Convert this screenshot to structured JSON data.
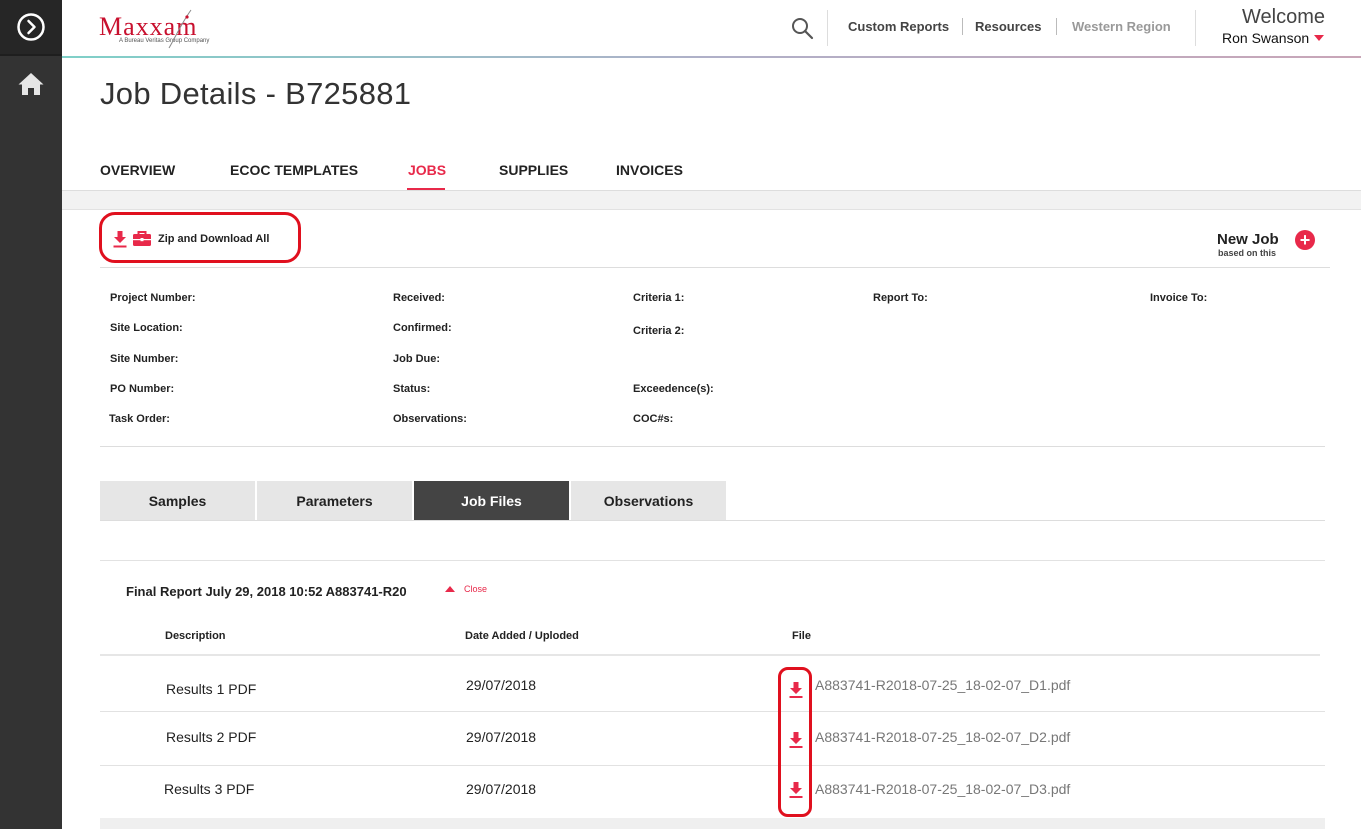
{
  "sidebar": {
    "items": [
      {
        "icon": "chevron-right-circle-icon"
      },
      {
        "icon": "home-icon"
      }
    ]
  },
  "header": {
    "logo_text": "Maxxam",
    "logo_sub": "A Bureau Veritas Group Company",
    "nav": [
      "Custom Reports",
      "Resources",
      "Western Region"
    ],
    "welcome": "Welcome",
    "user": "Ron Swanson"
  },
  "page": {
    "title": "Job Details - B725881",
    "tabs": [
      "OVERVIEW",
      "ECOC TEMPLATES",
      "JOBS",
      "SUPPLIES",
      "INVOICES"
    ],
    "active_tab": "JOBS"
  },
  "toolbar": {
    "zip_label": "Zip and Download All",
    "new_job_title": "New Job",
    "new_job_sub": "based on this"
  },
  "details": {
    "col1": [
      "Project Number:",
      "Site Location:",
      "Site Number:",
      "PO Number:",
      "Task Order:"
    ],
    "col2": [
      "Received:",
      "Confirmed:",
      "Job Due:",
      "Status:",
      "Observations:"
    ],
    "col3": [
      "Criteria 1:",
      "Criteria 2:",
      "Exceedence(s):",
      "COC#s:"
    ],
    "col4": [
      "Report To:"
    ],
    "col5": [
      "Invoice To:"
    ]
  },
  "section_tabs": [
    "Samples",
    "Parameters",
    "Job Files",
    "Observations"
  ],
  "active_section": "Job Files",
  "report": {
    "title": "Final Report July 29, 2018 10:52 A883741-R20",
    "close_label": "Close",
    "columns": [
      "Description",
      "Date Added / Uploded",
      "File"
    ],
    "rows": [
      {
        "description": "Results 1 PDF",
        "date": "29/07/2018",
        "file": "A883741-R2018-07-25_18-02-07_D1.pdf"
      },
      {
        "description": "Results 2 PDF",
        "date": "29/07/2018",
        "file": "A883741-R2018-07-25_18-02-07_D2.pdf"
      },
      {
        "description": "Results 3 PDF",
        "date": "29/07/2018",
        "file": "A883741-R2018-07-25_18-02-07_D3.pdf"
      }
    ]
  },
  "colors": {
    "accent": "#e8294a",
    "sidebar": "#333333",
    "annotation": "#e0101e"
  }
}
